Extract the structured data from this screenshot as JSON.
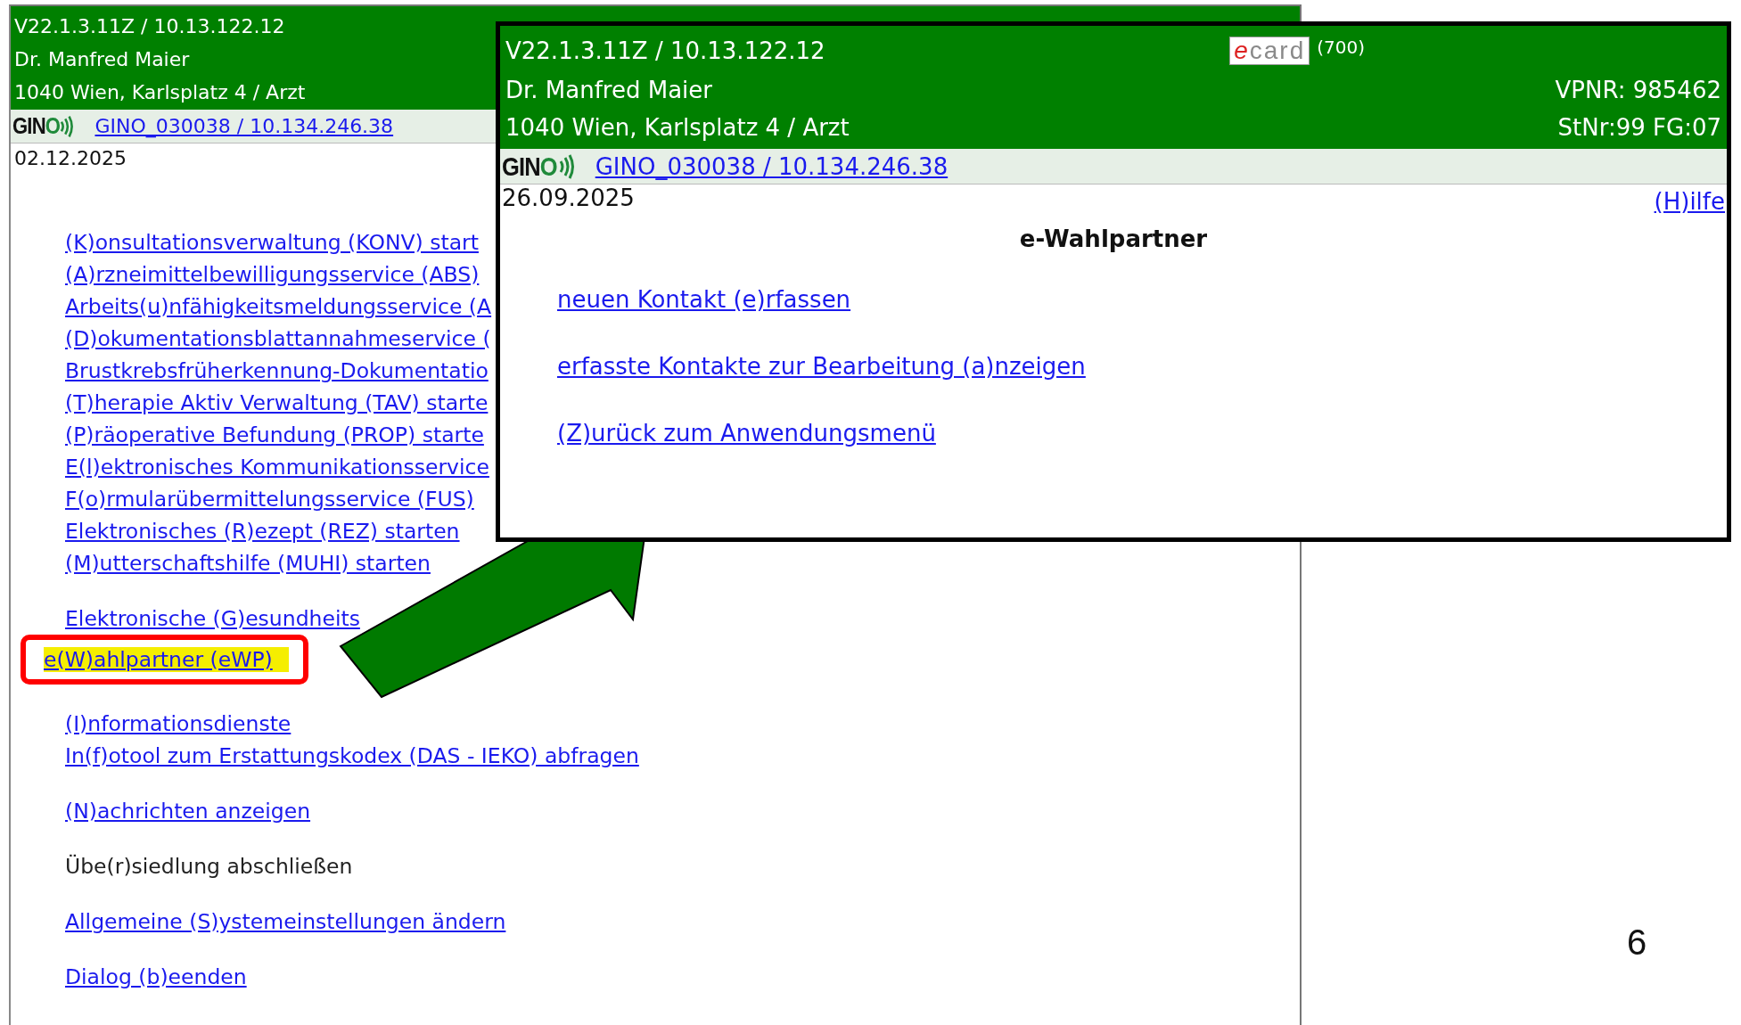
{
  "background_window": {
    "header": {
      "version": "V22.1.3.11Z / 10.13.122.12",
      "name": "Dr. Manfred Maier",
      "address": "1040 Wien, Karlsplatz 4 / Arzt"
    },
    "gino": {
      "logo": "GINO",
      "link": "GINO_030038 / 10.134.246.38"
    },
    "date": "02.12.2025",
    "menu_groups": [
      [
        {
          "label": "(K)onsultationsverwaltung (KONV) start",
          "disabled": false,
          "highlighted": false
        },
        {
          "label": "(A)rzneimittelbewilligungsservice (ABS)",
          "disabled": false,
          "highlighted": false
        },
        {
          "label": "Arbeits(u)nfähigkeitsmeldungsservice (A",
          "disabled": false,
          "highlighted": false
        },
        {
          "label": "(D)okumentationsblattannahmeservice (",
          "disabled": false,
          "highlighted": false
        },
        {
          "label": "Brustkrebsfrüherkennung-Dokumentatio",
          "disabled": false,
          "highlighted": false
        },
        {
          "label": "(T)herapie Aktiv Verwaltung (TAV) starte",
          "disabled": false,
          "highlighted": false
        },
        {
          "label": "(P)räoperative Befundung (PROP) starte",
          "disabled": false,
          "highlighted": false
        },
        {
          "label": "E(l)ektronisches Kommunikationsservice",
          "disabled": false,
          "highlighted": false
        },
        {
          "label": "F(o)rmularübermittelungsservice (FUS)",
          "disabled": false,
          "highlighted": false
        },
        {
          "label": "Elektronisches (R)ezept (REZ) starten",
          "disabled": false,
          "highlighted": false
        },
        {
          "label": "(M)utterschaftshilfe (MUHI) starten",
          "disabled": false,
          "highlighted": false
        }
      ],
      [
        {
          "label": "Elektronische (G)esundheits",
          "disabled": false,
          "highlighted": false
        },
        {
          "label": "e(W)ahlpartner (eWP)",
          "disabled": false,
          "highlighted": true
        }
      ],
      [
        {
          "label": "(I)nformationsdienste",
          "disabled": false,
          "highlighted": false
        },
        {
          "label": "In(f)otool zum Erstattungskodex (DAS - IEKO) abfragen",
          "disabled": false,
          "highlighted": false
        }
      ],
      [
        {
          "label": "(N)achrichten anzeigen",
          "disabled": false,
          "highlighted": false
        }
      ],
      [
        {
          "label": "Übe(r)siedlung abschließen",
          "disabled": true,
          "highlighted": false
        }
      ],
      [
        {
          "label": "Allgemeine (S)ystemeinstellungen ändern",
          "disabled": false,
          "highlighted": false
        }
      ],
      [
        {
          "label": "Dialog (b)eenden",
          "disabled": false,
          "highlighted": false
        }
      ]
    ]
  },
  "foreground_window": {
    "header": {
      "version": "V22.1.3.11Z / 10.13.122.12",
      "ecard": "ecard",
      "card_code": "(700)",
      "name": "Dr. Manfred Maier",
      "vpnr": "VPNR: 985462",
      "address": "1040 Wien, Karlsplatz 4 / Arzt",
      "stnr": "StNr:99 FG:07"
    },
    "gino": {
      "logo": "GINO",
      "link": "GINO_030038 / 10.134.246.38"
    },
    "date": "26.09.2025",
    "help": "(H)ilfe",
    "title": "e-Wahlpartner",
    "links": [
      {
        "label": "neuen Kontakt (e)rfassen"
      },
      {
        "label": "erfasste Kontakte zur Bearbeitung (a)nzeigen"
      },
      {
        "label": "(Z)urück zum Anwendungsmenü"
      }
    ]
  },
  "page_number": "6"
}
